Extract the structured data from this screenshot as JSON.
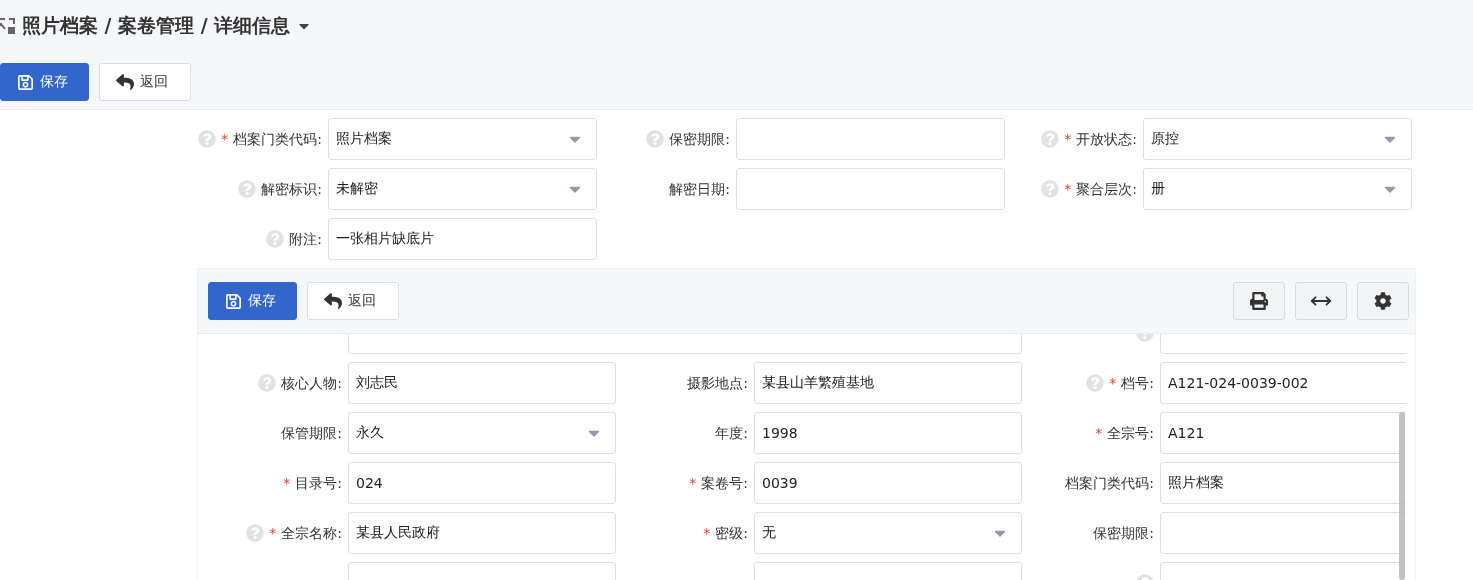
{
  "header": {
    "breadcrumb": "照片档案 / 案卷管理 / 详细信息",
    "buttons": [
      {
        "label": "保存",
        "kind": "primary"
      },
      {
        "label": "返回",
        "kind": "default"
      }
    ]
  },
  "form": {
    "fields": [
      {
        "label": "档案门类代码:",
        "mark": "*",
        "help": true,
        "kind": "select",
        "value": "照片档案"
      },
      {
        "label": "保密期限:",
        "help": true,
        "kind": "text"
      },
      {
        "label": "开放状态:",
        "mark": "*",
        "help": true,
        "kind": "select",
        "value": "原控"
      },
      {
        "label": "解密标识:",
        "help": true,
        "kind": "select",
        "value": "未解密"
      },
      {
        "label": "解密日期:",
        "kind": "text"
      },
      {
        "label": "聚合层次:",
        "mark": "*",
        "help": true,
        "kind": "select",
        "value": "册"
      },
      {
        "label": "附注:",
        "help": true,
        "kind": "text",
        "value": "一张相片缺底片"
      }
    ]
  },
  "detail": {
    "buttons": [
      {
        "label": "保存",
        "kind": "primary"
      },
      {
        "label": "返回",
        "kind": "default"
      }
    ],
    "tools": [
      {
        "kind": "print"
      },
      {
        "kind": "expand"
      },
      {
        "kind": "settings"
      }
    ],
    "rows": [
      [
        {
          "kind": "wide"
        },
        {
          "kind": "text",
          "help": true
        }
      ],
      [
        {
          "label": "核心人物:",
          "help": true,
          "kind": "text",
          "value": "刘志民"
        },
        {
          "label": "摄影地点:",
          "kind": "text",
          "value": "某县山羊繁殖基地"
        },
        {
          "label": "档号:",
          "mark": "*",
          "help": true,
          "kind": "text",
          "value": "A121-024-0039-002"
        }
      ],
      [
        {
          "label": "保管期限:",
          "kind": "select",
          "value": "永久"
        },
        {
          "label": "年度:",
          "kind": "text",
          "value": "1998"
        },
        {
          "label": "全宗号:",
          "mark": "*",
          "kind": "text",
          "value": "A121"
        }
      ],
      [
        {
          "label": "目录号:",
          "mark": "*",
          "kind": "text",
          "value": "024"
        },
        {
          "label": "案卷号:",
          "mark": "*",
          "kind": "text",
          "value": "0039"
        },
        {
          "label": "档案门类代码:",
          "kind": "text",
          "value": "照片档案"
        }
      ],
      [
        {
          "label": "全宗名称:",
          "mark": "*",
          "help": true,
          "kind": "text",
          "value": "某县人民政府"
        },
        {
          "label": "密级:",
          "mark": "*",
          "kind": "select",
          "value": "无"
        },
        {
          "label": "保密期限:",
          "kind": "text"
        }
      ],
      [
        {
          "kind": "text"
        },
        {
          "kind": "text"
        },
        {
          "kind": "text",
          "help": true
        }
      ]
    ]
  }
}
